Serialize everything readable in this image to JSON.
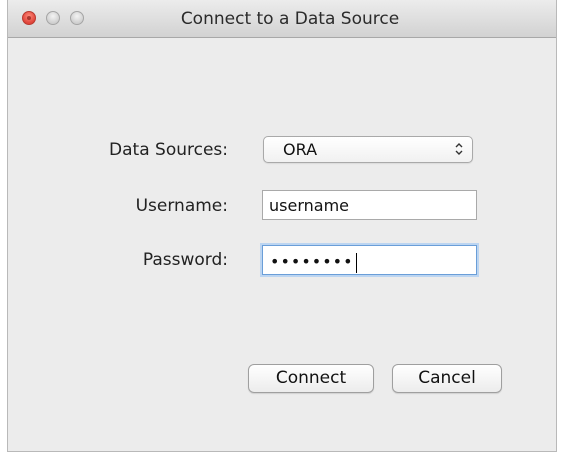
{
  "window": {
    "title": "Connect to a Data Source"
  },
  "form": {
    "data_sources_label": "Data Sources:",
    "data_sources_value": "ORA",
    "username_label": "Username:",
    "username_value": "username",
    "password_label": "Password:",
    "password_masked": "••••••••"
  },
  "buttons": {
    "connect_label": "Connect",
    "cancel_label": "Cancel"
  },
  "icons": {
    "close": "close-button-red",
    "minimize": "minimize-button-gray",
    "zoom": "zoom-button-gray",
    "select_arrows": "up-down-chevron-icon"
  },
  "colors": {
    "focus_ring": "#6a9ed8",
    "close_red": "#e0443a"
  }
}
